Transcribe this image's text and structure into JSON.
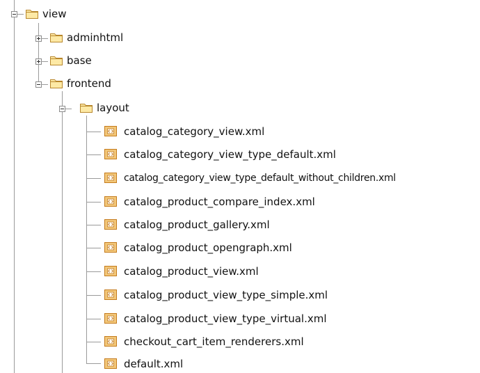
{
  "tree": {
    "colors": {
      "connector": "#9a9a9a",
      "folder_fill": "#fde9a5",
      "folder_stroke": "#b8862b",
      "xml_fill": "#f2c77a",
      "xml_stroke": "#c47a1b",
      "xml_accent": "#ffffff"
    },
    "folders": {
      "view": {
        "label": "view",
        "expanded": true,
        "icon": "folder-icon"
      },
      "adminhtml": {
        "label": "adminhtml",
        "expanded": false,
        "icon": "folder-icon"
      },
      "base": {
        "label": "base",
        "expanded": false,
        "icon": "folder-icon"
      },
      "frontend": {
        "label": "frontend",
        "expanded": true,
        "icon": "folder-icon"
      },
      "layout": {
        "label": "layout",
        "expanded": true,
        "icon": "folder-icon"
      }
    },
    "files": [
      {
        "label": "catalog_category_view.xml",
        "icon": "xml-file-icon"
      },
      {
        "label": "catalog_category_view_type_default.xml",
        "icon": "xml-file-icon"
      },
      {
        "label": "catalog_category_view_type_default_without_children.xml",
        "icon": "xml-file-icon"
      },
      {
        "label": "catalog_product_compare_index.xml",
        "icon": "xml-file-icon"
      },
      {
        "label": "catalog_product_gallery.xml",
        "icon": "xml-file-icon"
      },
      {
        "label": "catalog_product_opengraph.xml",
        "icon": "xml-file-icon"
      },
      {
        "label": "catalog_product_view.xml",
        "icon": "xml-file-icon"
      },
      {
        "label": "catalog_product_view_type_simple.xml",
        "icon": "xml-file-icon"
      },
      {
        "label": "catalog_product_view_type_virtual.xml",
        "icon": "xml-file-icon"
      },
      {
        "label": "checkout_cart_item_renderers.xml",
        "icon": "xml-file-icon"
      },
      {
        "label": "default.xml",
        "icon": "xml-file-icon"
      }
    ]
  }
}
